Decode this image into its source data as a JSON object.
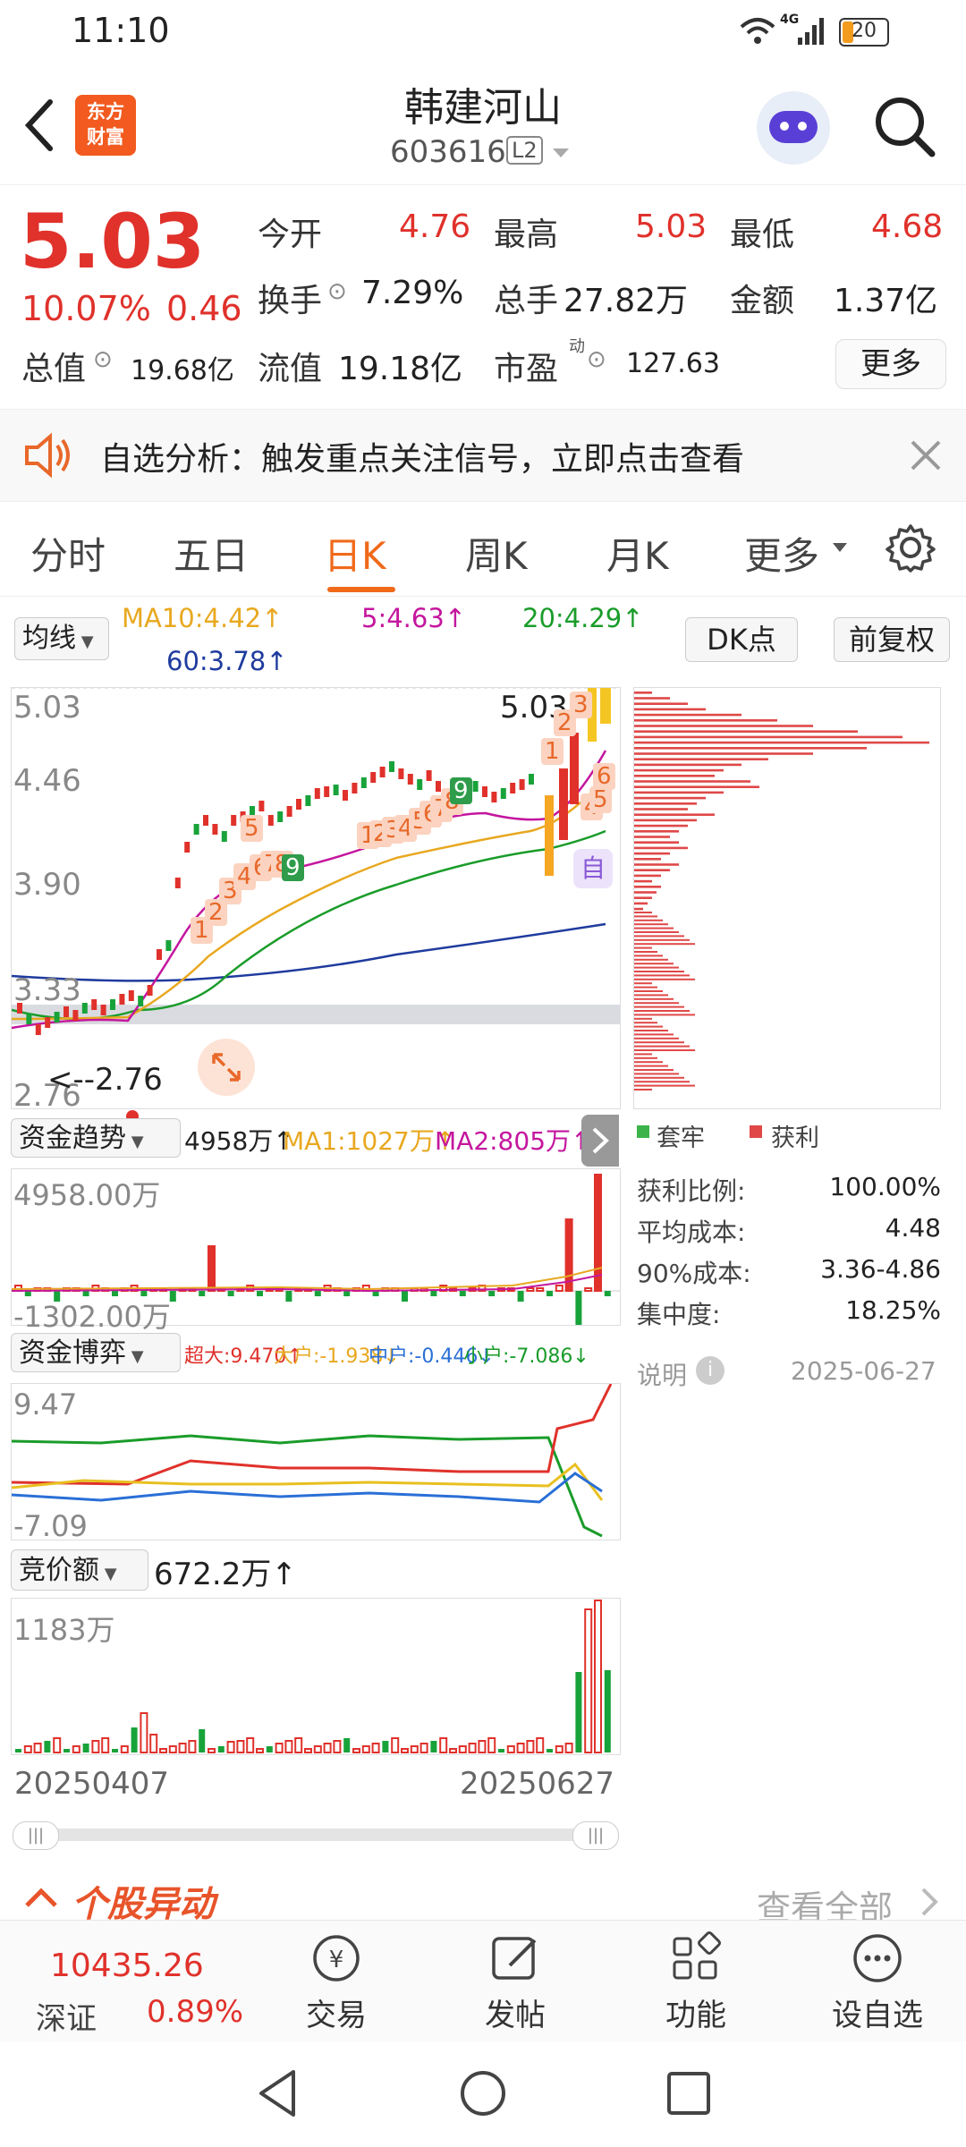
{
  "status": {
    "time": "11:10",
    "network": "4G",
    "battery": "20"
  },
  "header": {
    "title": "韩建河山",
    "code": "603616",
    "level": "L2",
    "logo_line1": "东方",
    "logo_line2": "财富"
  },
  "quote": {
    "price": "5.03",
    "change_pct": "10.07%",
    "change": "0.46",
    "open_label": "今开",
    "open": "4.76",
    "high_label": "最高",
    "high": "5.03",
    "low_label": "最低",
    "low": "4.68",
    "turnover_label": "换手",
    "turnover": "7.29%",
    "volume_label": "总手",
    "volume": "27.82万",
    "amount_label": "金额",
    "amount": "1.37亿",
    "total_mv_label": "总值",
    "total_mv": "19.68亿",
    "float_mv_label": "流值",
    "float_mv": "19.18亿",
    "pe_label": "市盈",
    "pe_sup": "动",
    "pe": "127.63",
    "more_btn": "更多"
  },
  "banner": {
    "text": "自选分析：触发重点关注信号，立即点击查看"
  },
  "tabs": [
    "分时",
    "五日",
    "日K",
    "周K",
    "月K",
    "更多"
  ],
  "active_tab": "日K",
  "kline": {
    "ma_select": "均线",
    "ma10": "MA10:4.42↑",
    "ma5": "5:4.63↑",
    "ma20": "20:4.29↑",
    "ma60": "60:3.78↑",
    "dk_btn": "DK点",
    "adj_btn": "前复权",
    "y_labels": [
      "5.03",
      "4.46",
      "3.90",
      "3.33",
      "2.76"
    ],
    "last_price_tag": "5.03>",
    "low_tag": "<--2.76",
    "self_tag": "自",
    "seq_labels": [
      "1",
      "2",
      "3",
      "4",
      "5",
      "6",
      "7",
      "8",
      "9",
      "1",
      "2",
      "3",
      "4",
      "5",
      "6",
      "7",
      "8",
      "9",
      "1",
      "2",
      "3",
      "6",
      "4",
      "5"
    ]
  },
  "chip": {
    "legend_stuck": "套牢",
    "legend_profit": "获利",
    "rows": [
      {
        "label": "获利比例:",
        "value": "100.00%"
      },
      {
        "label": "平均成本:",
        "value": "4.48"
      },
      {
        "label": "90%成本:",
        "value": "3.36-4.86"
      },
      {
        "label": "集中度:",
        "value": "18.25%"
      }
    ],
    "note_label": "说明",
    "date": "2025-06-27",
    "profit_color": "#e04848",
    "stuck_color": "#3cb44b"
  },
  "fund_trend": {
    "select": "资金趋势",
    "value": "4958万↑",
    "ma1": "MA1:1027万↑",
    "ma2": "MA2:805万↑",
    "top": "4958.00万",
    "bottom": "-1302.00万"
  },
  "fund_game": {
    "select": "资金博弈",
    "super": "超大:9.470↑",
    "big": "大户:-1.938↓",
    "mid": "中户:-0.446↓",
    "small": "小户:-7.086↓",
    "top": "9.47",
    "bottom": "-7.09"
  },
  "auction": {
    "select": "竞价额",
    "value": "672.2万↑",
    "top": "1183万"
  },
  "dates": {
    "start": "20250407",
    "end": "20250627"
  },
  "news": {
    "title": "个股异动",
    "more": "查看全部"
  },
  "bottom_bar": {
    "index_value": "10435.26",
    "index_name": "深证",
    "index_pct": "0.89%",
    "items": [
      "交易",
      "发帖",
      "功能",
      "设自选"
    ]
  },
  "chart_data": [
    {
      "type": "bar",
      "title": "竞价额",
      "categories": [
        "20250407",
        "20250627"
      ],
      "values": [],
      "ylim": [
        0,
        1183
      ]
    }
  ]
}
